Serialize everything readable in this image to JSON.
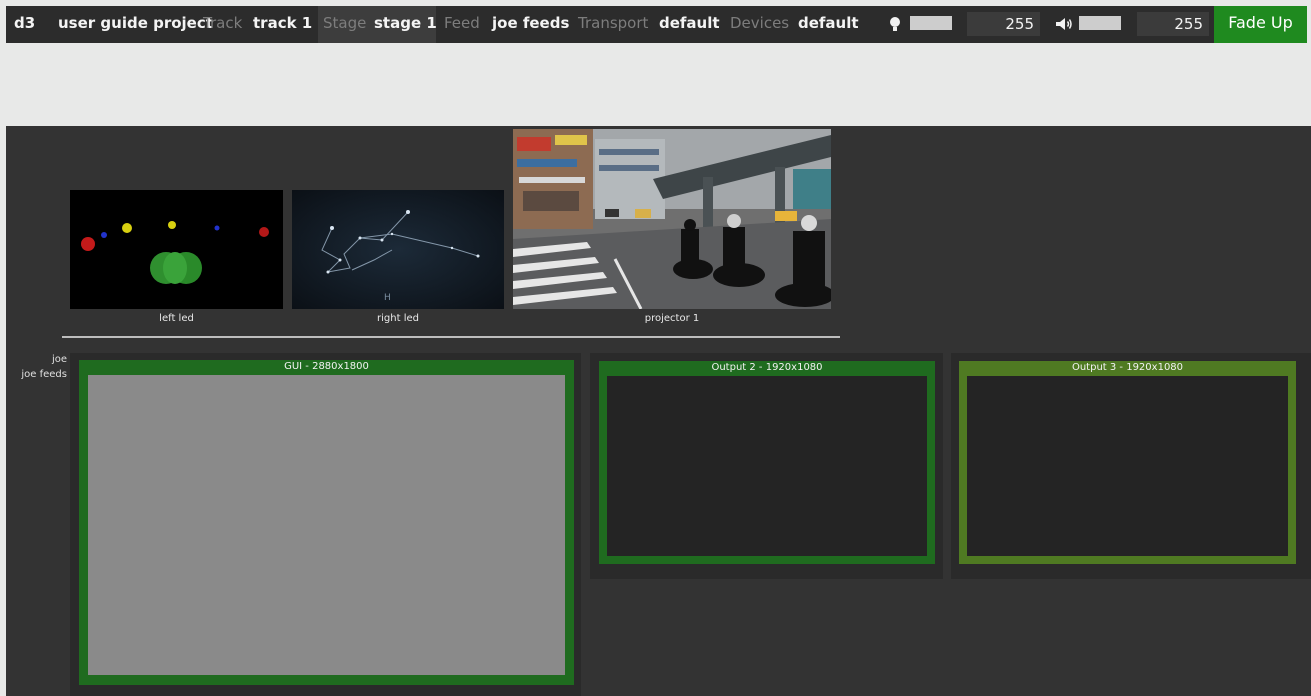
{
  "topbar": {
    "app": "d3",
    "project": "user guide project",
    "track_label": "Track",
    "track_value": "track 1",
    "stage_label": "Stage",
    "stage_value": "stage 1",
    "feed_label": "Feed",
    "feed_value": "joe feeds",
    "transport_label": "Transport",
    "transport_value": "default",
    "devices_label": "Devices",
    "devices_value": "default",
    "brightness_value": "255",
    "volume_value": "255",
    "fade_up_label": "Fade Up"
  },
  "screens": [
    {
      "label": "left led"
    },
    {
      "label": "right led"
    },
    {
      "label": "projector 1"
    }
  ],
  "feed": {
    "user": "joe",
    "name": "joe feeds"
  },
  "outputs": [
    {
      "title": "GUI - 2880x1800"
    },
    {
      "title": "Output 2 - 1920x1080"
    },
    {
      "title": "Output 3 - 1920x1080"
    }
  ],
  "colors": {
    "accent_green": "#1f8a1f",
    "output_frame_green": "#1f6b1f",
    "output_3_frame_green": "#4f7a22"
  }
}
